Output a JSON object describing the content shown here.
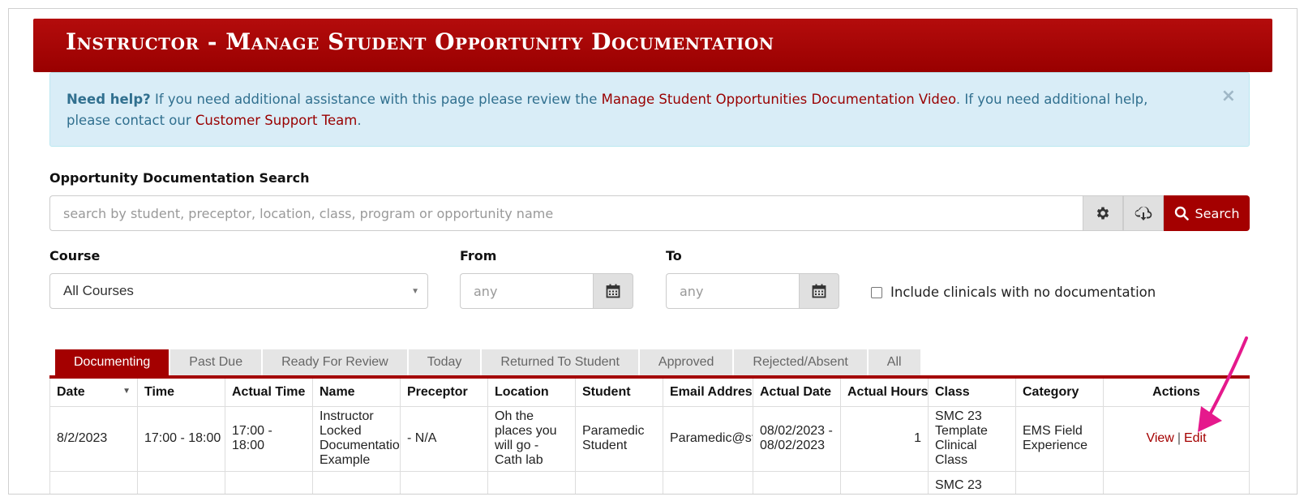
{
  "header": {
    "title": "Instructor - Manage Student Opportunity Documentation"
  },
  "alert": {
    "strong": "Need help?",
    "text1": " If you need additional assistance with this page please review the ",
    "link1": "Manage Student Opportunities Documentation Video",
    "text2": ". If you need additional help, please contact our ",
    "link2": "Customer Support Team",
    "text3": ".",
    "close": "×"
  },
  "search": {
    "label": "Opportunity Documentation Search",
    "placeholder": "search by student, preceptor, location, class, program or opportunity name",
    "button_label": "Search"
  },
  "filters": {
    "course_label": "Course",
    "course_value": "All Courses",
    "from_label": "From",
    "from_placeholder": "any",
    "to_label": "To",
    "to_placeholder": "any",
    "checkbox_label": "Include clinicals with no documentation"
  },
  "tabs": [
    "Documenting",
    "Past Due",
    "Ready For Review",
    "Today",
    "Returned To Student",
    "Approved",
    "Rejected/Absent",
    "All"
  ],
  "table": {
    "headers": [
      "Date",
      "Time",
      "Actual Time",
      "Name",
      "Preceptor",
      "Location",
      "Student",
      "Email Address",
      "Actual Date",
      "Actual Hours",
      "Class",
      "Category",
      "Actions"
    ],
    "rows": [
      {
        "date": "8/2/2023",
        "time": "17:00 - 18:00",
        "actual_time": "17:00 - 18:00",
        "name": "Instructor Locked Documentation Example",
        "preceptor": "- N/A",
        "location": "Oh the places you will go - Cath lab",
        "student": "Paramedic Student",
        "email": "Paramedic@st",
        "actual_date": "08/02/2023 - 08/02/2023",
        "actual_hours": "1",
        "class": "SMC 23 Template Clinical Class",
        "category": "EMS Field Experience",
        "view": "View",
        "edit": "Edit"
      }
    ],
    "partial_row_class": "SMC 23"
  },
  "colors": {
    "brand": "#a40000",
    "alert_bg": "#d9edf7",
    "arrow": "#e5198c"
  },
  "icons": [
    "gear-icon",
    "cloud-download-icon",
    "search-icon",
    "calendar-icon",
    "sort-desc-icon",
    "close-icon",
    "arrow-annotation"
  ]
}
